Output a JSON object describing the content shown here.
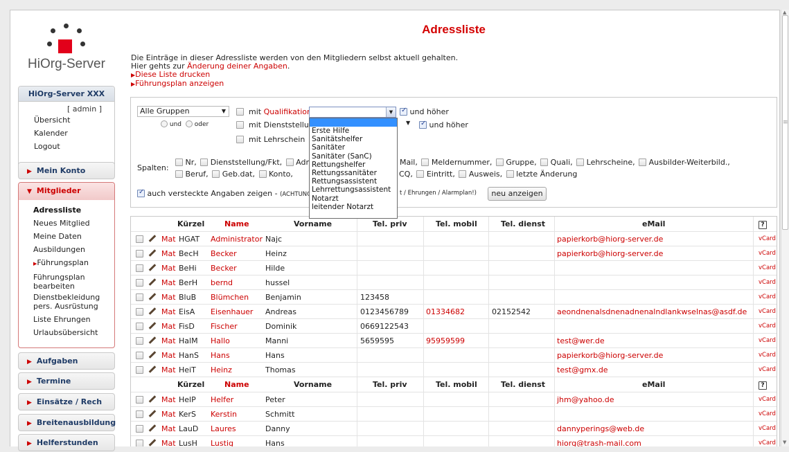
{
  "app": {
    "logo_text": "HiOrg-Server",
    "accent": "#cc0000",
    "brand_red": "#e2001a",
    "nav_blue": "#1f3b66"
  },
  "sidebar": {
    "org_title": "HiOrg-Server XXX",
    "user": "[ admin ]",
    "links": [
      "Übersicht",
      "Kalender",
      "Logout"
    ],
    "mein_konto": "Mein Konto",
    "mitglieder": "Mitglieder",
    "mitglieder_items": [
      {
        "label": "Adressliste"
      },
      {
        "label": "Neues Mitglied"
      },
      {
        "label": "Meine Daten"
      },
      {
        "label": "Ausbildungen"
      },
      {
        "label": "Führungsplan"
      },
      {
        "label": "Führungsplan bearbeiten"
      },
      {
        "label": "Dienstbekleidung pers. Ausrüstung"
      },
      {
        "label": "Liste Ehrungen"
      },
      {
        "label": "Urlaubsübersicht"
      }
    ],
    "sections": [
      "Aufgaben",
      "Termine",
      "Einsätze / Rech",
      "Breitenausbildung",
      "Helferstunden"
    ]
  },
  "main": {
    "title": "Adressliste",
    "intro_line": "Die Einträge in dieser Adressliste werden von den Mitgliedern selbst aktuell gehalten.",
    "intro_prefix": "Hier gehts zur",
    "intro_link": "Änderung deiner Angaben",
    "intro_end": ".",
    "link_print": "Diese Liste drucken",
    "link_plan": "Führungsplan anzeigen"
  },
  "filter": {
    "group_value": "Alle Gruppen",
    "und": "und",
    "oder": "oder",
    "mit": "mit",
    "qualifikation": "Qualifikation",
    "dienststellung": "Dienststellung",
    "lehrschein": "mit Lehrschein",
    "und_hoeher": "und höher",
    "spalten_label": "Spalten:",
    "columns_row1": [
      "Nr,",
      "Dienststellung/Fkt,",
      "Adr",
      "Mail,",
      "Meldernummer,",
      "Gruppe,",
      "Quali,",
      "Lehrscheine,",
      "Ausbilder-Weiterbild.,"
    ],
    "columns_row2": [
      "Beruf,",
      "Geb.dat,",
      "Konto,",
      "CQ,",
      "Eintritt,",
      "Ausweis,",
      "letzte Änderung"
    ],
    "hidden_label": "auch versteckte Angaben zeigen -",
    "hidden_note_a": "(ACHTUNG",
    "hidden_note_b": "t / Ehrungen / Alarmplan!)",
    "submit": "neu anzeigen",
    "dropdown_options": [
      "Erste Hilfe",
      "Sanitätshelfer",
      "Sanitäter",
      "Sanitäter (SanC)",
      "Rettungshelfer",
      "Rettungssanitäter",
      "Rettungsassistent",
      "Lehrrettungsassistent",
      "Notarzt",
      "leitender Notarzt"
    ]
  },
  "table": {
    "headers": {
      "kuerzel": "Kürzel",
      "name": "Name",
      "vorname": "Vorname",
      "tel_priv": "Tel. priv",
      "tel_mobil": "Tel. mobil",
      "tel_dienst": "Tel. dienst",
      "email": "eMail",
      "help": "?"
    },
    "mat": "Mat",
    "vcard": "vCard",
    "rows_a": [
      {
        "k": "HGAT",
        "name": "Administrator",
        "vorname": "Najc",
        "priv": "",
        "mobil": "",
        "dienst": "",
        "email": "papierkorb@hiorg-server.de"
      },
      {
        "k": "BecH",
        "name": "Becker",
        "vorname": "Heinz",
        "priv": "",
        "mobil": "",
        "dienst": "",
        "email": "papierkorb@hiorg-server.de"
      },
      {
        "k": "BeHi",
        "name": "Becker",
        "vorname": "Hilde",
        "priv": "",
        "mobil": "",
        "dienst": "",
        "email": ""
      },
      {
        "k": "BerH",
        "name": "bernd",
        "vorname": "hussel",
        "priv": "",
        "mobil": "",
        "dienst": "",
        "email": ""
      },
      {
        "k": "BluB",
        "name": "Blümchen",
        "vorname": "Benjamin",
        "priv": "123458",
        "mobil": "",
        "dienst": "",
        "email": ""
      },
      {
        "k": "EisA",
        "name": "Eisenhauer",
        "vorname": "Andreas",
        "priv": "0123456789",
        "mobil": "01334682",
        "dienst": "02152542",
        "email": "aeondnenalsdnenadnenalndlankwselnas@asdf.de"
      },
      {
        "k": "FisD",
        "name": "Fischer",
        "vorname": "Dominik",
        "priv": "0669122543",
        "mobil": "",
        "dienst": "",
        "email": ""
      },
      {
        "k": "HalM",
        "name": "Hallo",
        "vorname": "Manni",
        "priv": "5659595",
        "mobil": "95959599",
        "dienst": "",
        "email": "test@wer.de"
      },
      {
        "k": "HanS",
        "name": "Hans",
        "vorname": "Hans",
        "priv": "",
        "mobil": "",
        "dienst": "",
        "email": "papierkorb@hiorg-server.de"
      },
      {
        "k": "HeiT",
        "name": "Heinz",
        "vorname": "Thomas",
        "priv": "",
        "mobil": "",
        "dienst": "",
        "email": "test@gmx.de"
      }
    ],
    "rows_b": [
      {
        "k": "HelP",
        "name": "Helfer",
        "vorname": "Peter",
        "priv": "",
        "mobil": "",
        "dienst": "",
        "email": "jhm@yahoo.de"
      },
      {
        "k": "KerS",
        "name": "Kerstin",
        "vorname": "Schmitt",
        "priv": "",
        "mobil": "",
        "dienst": "",
        "email": ""
      },
      {
        "k": "LauD",
        "name": "Laures",
        "vorname": "Danny",
        "priv": "",
        "mobil": "",
        "dienst": "",
        "email": "dannyperings@web.de"
      },
      {
        "k": "LusH",
        "name": "Lustig",
        "vorname": "Hans",
        "priv": "",
        "mobil": "",
        "dienst": "",
        "email": "hiorg@trash-mail.com"
      }
    ]
  }
}
